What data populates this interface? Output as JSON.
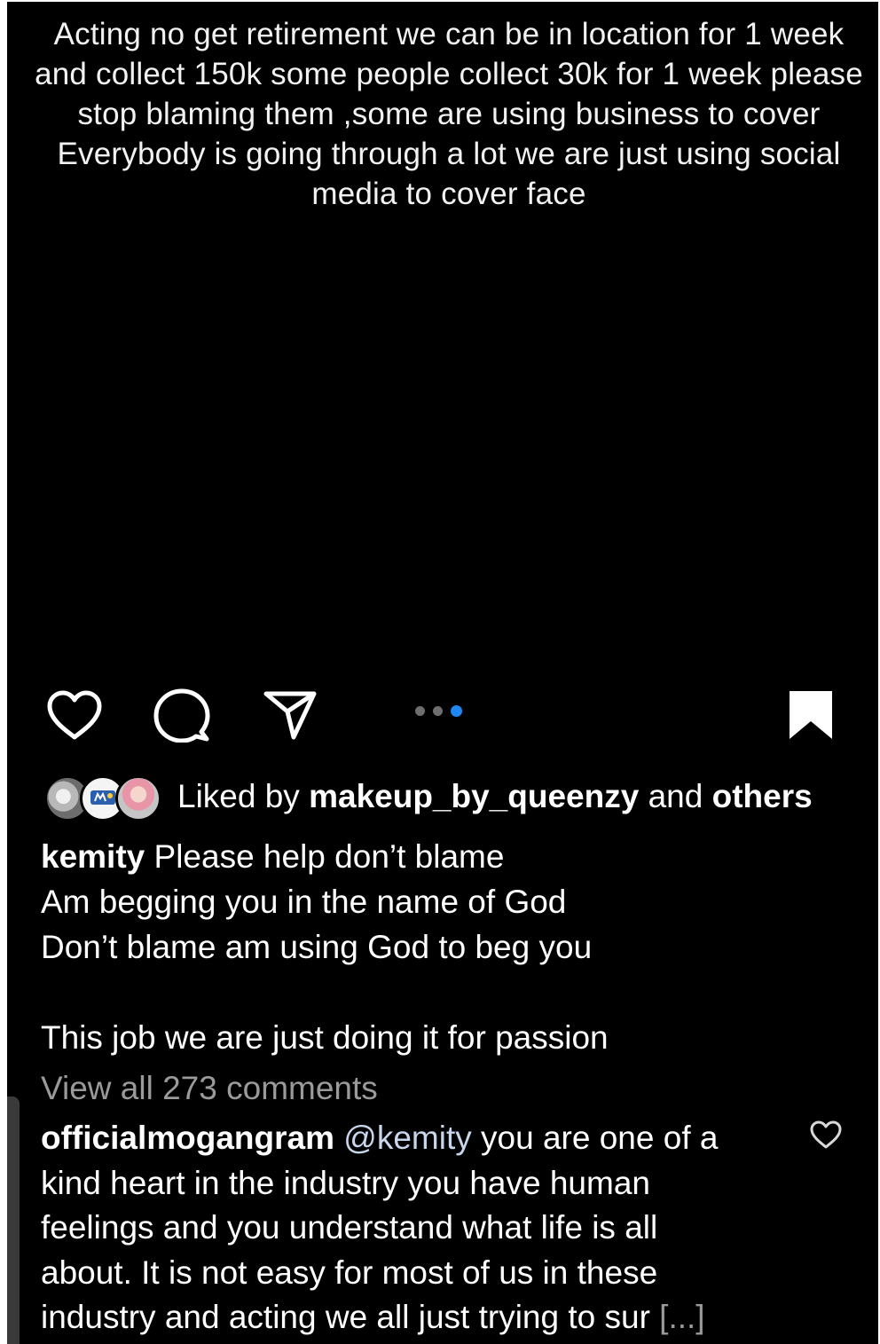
{
  "post": {
    "image_text": "Acting no get retirement we can be in location for 1 week and collect 150k some people collect 30k for 1 week please stop blaming them ,some are using business to cover Everybody is going through a lot we are just using social media to cover face",
    "carousel": {
      "count": 3,
      "active_index": 2
    }
  },
  "actions": {
    "like_icon": "heart-icon",
    "comment_icon": "comment-bubble-icon",
    "share_icon": "send-icon",
    "save_icon": "bookmark-icon"
  },
  "likes": {
    "prefix": "Liked by",
    "user": "makeup_by_queenzy",
    "conjunction": "and",
    "others": "others"
  },
  "caption": {
    "user": "kemity",
    "lines": [
      "Please help don’t blame",
      "Am begging you in the name of God",
      "Don’t blame am using God to beg you",
      "",
      "This job we are just doing it for passion"
    ]
  },
  "comments": {
    "view_all": "View all 273 comments",
    "top": {
      "user": "officialmogangram",
      "mention": "@kemity",
      "lines": [
        "you are one of a",
        "kind heart in the industry you have human",
        "feelings and you understand what life is all",
        "about. It is not easy for most of us in these",
        "industry and acting we all just trying to sur"
      ],
      "more": "[...]"
    }
  },
  "colors": {
    "background": "#000000",
    "accent": "#1e88f0",
    "muted": "#9a9a9a"
  }
}
